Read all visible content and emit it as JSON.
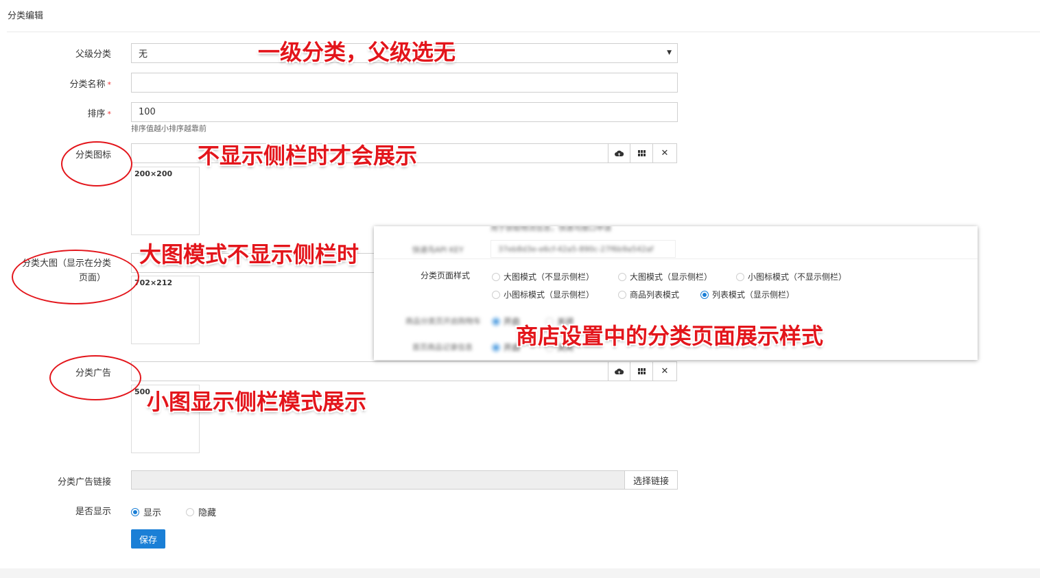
{
  "page": {
    "title": "分类编辑"
  },
  "form": {
    "parent": {
      "label": "父级分类",
      "value": "无"
    },
    "name": {
      "label": "分类名称",
      "required_mark": "*",
      "value": ""
    },
    "sort": {
      "label": "排序",
      "required_mark": "*",
      "value": "100",
      "hint": "排序值越小排序越靠前"
    },
    "icon": {
      "label": "分类图标",
      "size_hint": "200×200"
    },
    "big_image": {
      "label_line1": "分类大图（显示在分类",
      "label_line2": "页面）",
      "size_hint": "702×212"
    },
    "ad": {
      "label": "分类广告",
      "size_hint": "500"
    },
    "ad_link": {
      "label": "分类广告链接",
      "button": "选择链接"
    },
    "visible": {
      "label": "是否显示",
      "options": [
        "显示",
        "隐藏"
      ],
      "selected": "显示"
    },
    "save_button": "保存"
  },
  "inset": {
    "blurred_top": "用于获取物流信息，快递鸟接口申请",
    "blurred_key_label": "快递鸟API KEY",
    "blurred_key_value": "37eb8d3e-e6cf-42a5-890c-27f6b9a542af",
    "style_label": "分类页面样式",
    "style_options": [
      "大图模式（不显示侧栏）",
      "大图模式（显示侧栏）",
      "小图标模式（不显示侧栏）",
      "小图标模式（显示侧栏）",
      "商品列表模式",
      "列表模式（显示侧栏）"
    ],
    "style_selected": "列表模式（显示侧栏）",
    "blurred_row1_label": "商品分类页开启购物车",
    "blurred_row1_opt": "开启",
    "blurred_row1_opt2": "关闭",
    "blurred_row2_label": "首页商品记录信息",
    "blurred_row2_opt": "开启",
    "blurred_row2_opt2": "关闭"
  },
  "annotations": {
    "a1": "一级分类，父级选无",
    "a2": "不显示侧栏时才会展示",
    "a3": "大图模式不显示侧栏时",
    "a4": "商店设置中的分类页面展示样式",
    "a5": "小图显示侧栏模式展示"
  },
  "colors": {
    "primary": "#1a7fd6",
    "annotation": "#e3151b",
    "required": "#ee3333"
  }
}
